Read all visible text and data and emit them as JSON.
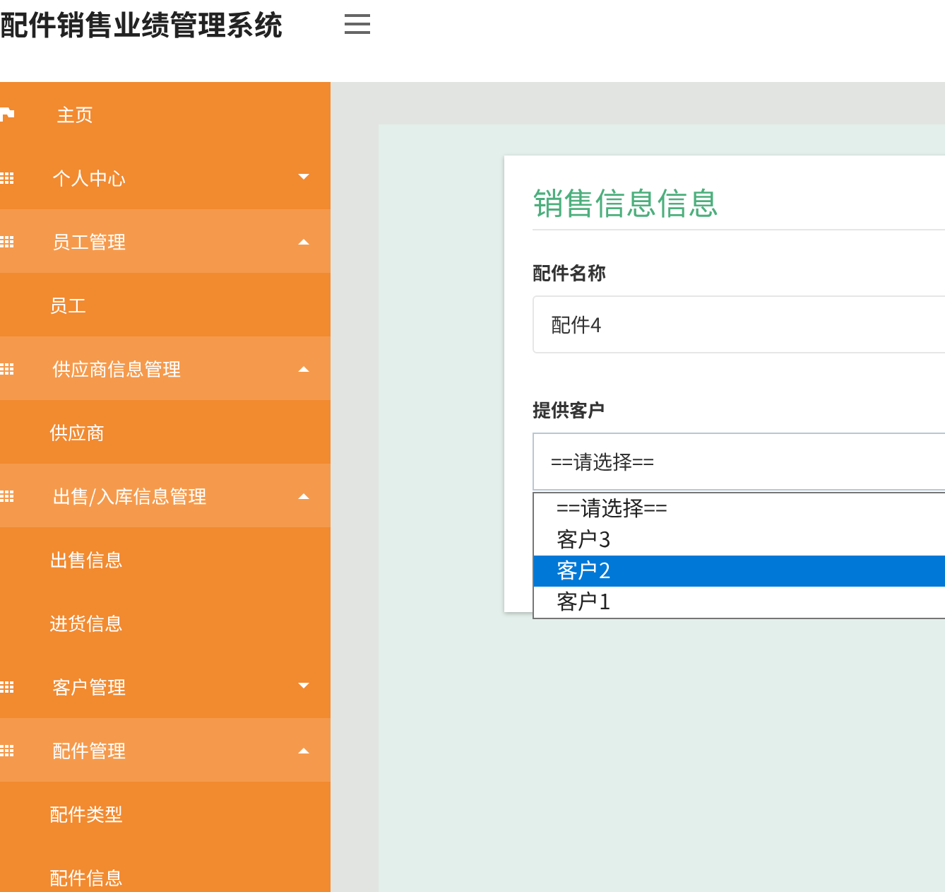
{
  "header": {
    "title": "配件销售业绩管理系统"
  },
  "sidebar": {
    "items": [
      {
        "kind": "link",
        "label": "主页",
        "expanded": false
      },
      {
        "kind": "group",
        "label": "个人中心",
        "expanded": false
      },
      {
        "kind": "group",
        "label": "员工管理",
        "expanded": true,
        "children": [
          {
            "label": "员工"
          }
        ]
      },
      {
        "kind": "group",
        "label": "供应商信息管理",
        "expanded": true,
        "children": [
          {
            "label": "供应商"
          }
        ]
      },
      {
        "kind": "group",
        "label": "出售/入库信息管理",
        "expanded": true,
        "children": [
          {
            "label": "出售信息"
          },
          {
            "label": "进货信息"
          }
        ]
      },
      {
        "kind": "group",
        "label": "客户管理",
        "expanded": false
      },
      {
        "kind": "group",
        "label": "配件管理",
        "expanded": true,
        "children": [
          {
            "label": "配件类型"
          },
          {
            "label": "配件信息"
          }
        ]
      }
    ]
  },
  "form": {
    "title": "销售信息信息",
    "fields": [
      {
        "kind": "input",
        "label": "配件名称",
        "value": "配件4"
      },
      {
        "kind": "select",
        "label": "提供客户",
        "value": "==请选择==",
        "open": true,
        "options": [
          {
            "label": "==请选择==",
            "highlighted": false
          },
          {
            "label": "客户3",
            "highlighted": false
          },
          {
            "label": "客户2",
            "highlighted": true
          },
          {
            "label": "客户1",
            "highlighted": false
          }
        ]
      }
    ]
  }
}
